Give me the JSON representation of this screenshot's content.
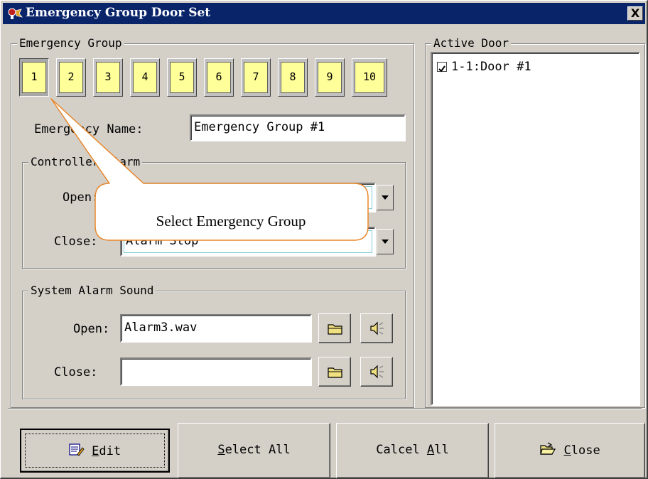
{
  "window": {
    "title": "Emergency Group Door Set",
    "close_glyph": "X",
    "icon": "app-icon"
  },
  "emergency_group": {
    "legend": "Emergency Group",
    "buttons": [
      "1",
      "2",
      "3",
      "4",
      "5",
      "6",
      "7",
      "8",
      "9",
      "10"
    ],
    "selected": "1",
    "name_label": "Emergency Name:",
    "name_value": "Emergency Group #1"
  },
  "controller_alarm": {
    "legend": "Controller Alarm",
    "open_label": "Open:",
    "open_value": "",
    "close_label": "Close:",
    "close_value": "Alarm Stop"
  },
  "system_alarm_sound": {
    "legend": "System Alarm Sound",
    "open_label": "Open:",
    "open_value": "Alarm3.wav",
    "close_label": "Close:",
    "close_value": "",
    "browse_icon": "folder-icon",
    "play_icon": "speaker-icon"
  },
  "active_door": {
    "legend": "Active Door",
    "items": [
      {
        "label": "1-1:Door #1",
        "checked": true
      }
    ]
  },
  "buttons": {
    "edit": {
      "mnemonic": "E",
      "rest": "dit",
      "icon": "edit-icon"
    },
    "select_all": {
      "mnemonic": "S",
      "rest": "elect All"
    },
    "cancel_all": {
      "prefix": "Calcel ",
      "mnemonic": "A",
      "rest": "ll"
    },
    "close": {
      "mnemonic": "C",
      "rest": "lose",
      "icon": "open-folder-icon"
    }
  },
  "callout": {
    "text": "Select Emergency Group",
    "fill": "#ffffff",
    "stroke": "#e8872a"
  },
  "colors": {
    "dialog_bg": "#d4d0c8",
    "titlebar": "#0a246a",
    "group_button_face": "#ffff99"
  }
}
